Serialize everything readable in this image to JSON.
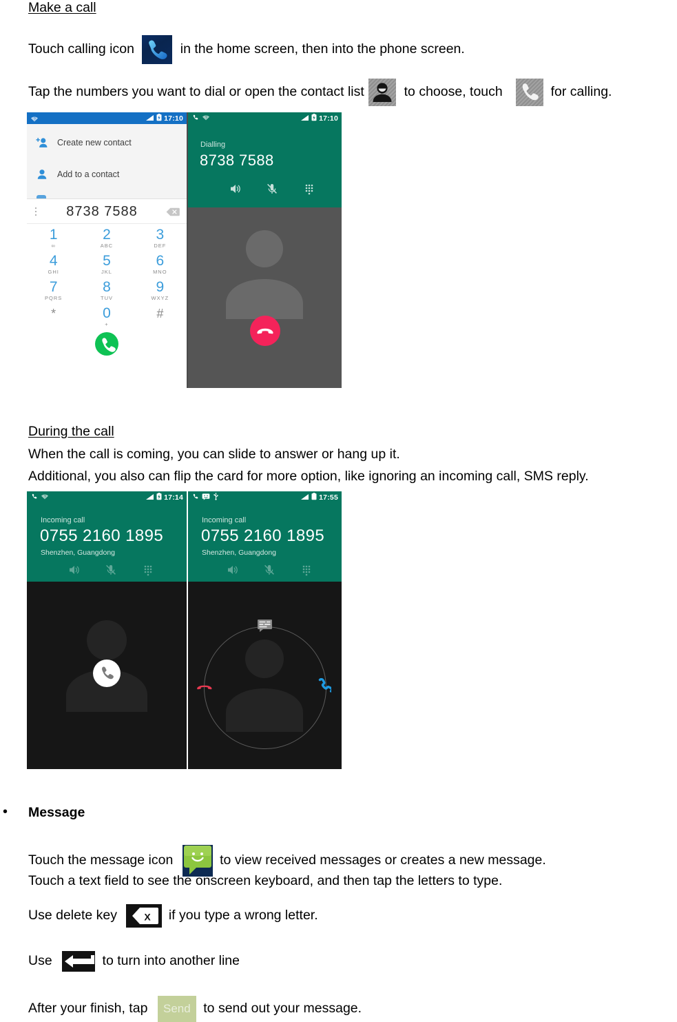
{
  "document": {
    "sections": [
      {
        "heading": "Make a call",
        "paragraphs": [
          {
            "before": "Touch calling icon",
            "icon": "phone-blue-icon",
            "after": "in the home screen, then into the phone screen."
          },
          {
            "before": "Tap the numbers you want to dial or open the contact list",
            "icon": "contact-person-icon",
            "middle": "to choose, touch",
            "icon2": "phone-handset-icon",
            "after": "for calling."
          }
        ]
      },
      {
        "heading": "During the call",
        "lines": [
          "When the call is coming, you can slide to answer or hang up it.",
          "Additional, you also can flip the card for more option, like ignoring an incoming call, SMS reply."
        ]
      },
      {
        "bullet": "•",
        "heading": "Message",
        "paragraphs": [
          {
            "before": "Touch the message icon",
            "icon": "message-bubble-icon",
            "after": "to view received messages or creates a new message."
          },
          {
            "plain": "Touch a text field to see the onscreen keyboard, and then tap the letters to type."
          },
          {
            "before": "Use delete key",
            "icon": "delete-key-icon",
            "after": "if you type a wrong letter."
          },
          {
            "before": "Use",
            "icon": "enter-key-icon",
            "after": "to turn into another line"
          },
          {
            "before": "After your finish, tap",
            "icon": "send-button-icon",
            "icon_label": "Send",
            "after": "to send out your message."
          }
        ]
      }
    ]
  },
  "figure_dialer": {
    "name": "dialer-and-dialling-screenshots",
    "left_screen": {
      "status": {
        "time": "17:10",
        "icons": [
          "wifi-icon",
          "signal-icon",
          "battery-icon"
        ]
      },
      "menu": [
        {
          "icon": "add-contact-icon",
          "label": "Create new contact"
        },
        {
          "icon": "person-icon",
          "label": "Add to a contact"
        }
      ],
      "number_field": {
        "value": "8738 7588",
        "overflow_icon": "more-vertical-icon",
        "backspace_icon": "backspace-icon"
      },
      "keypad": [
        {
          "digit": "1",
          "letters": "∞"
        },
        {
          "digit": "2",
          "letters": "ABC"
        },
        {
          "digit": "3",
          "letters": "DEF"
        },
        {
          "digit": "4",
          "letters": "GHI"
        },
        {
          "digit": "5",
          "letters": "JKL"
        },
        {
          "digit": "6",
          "letters": "MNO"
        },
        {
          "digit": "7",
          "letters": "PQRS"
        },
        {
          "digit": "8",
          "letters": "TUV"
        },
        {
          "digit": "9",
          "letters": "WXYZ"
        },
        {
          "digit": "*",
          "letters": ""
        },
        {
          "digit": "0",
          "letters": "+"
        },
        {
          "digit": "#",
          "letters": ""
        }
      ],
      "call_button": "call-fab-icon"
    },
    "right_screen": {
      "status": {
        "time": "17:10",
        "icons": [
          "call-icon",
          "wifi-icon",
          "signal-icon",
          "battery-icon"
        ]
      },
      "state": "Dialling",
      "number": "8738 7588",
      "actions": [
        "speaker-icon",
        "mute-icon",
        "keypad-icon"
      ],
      "end_call_button": "end-call-icon"
    }
  },
  "figure_incoming": {
    "name": "incoming-call-screenshots",
    "left_screen": {
      "status": {
        "time": "17:14",
        "icons": [
          "call-icon",
          "wifi-icon",
          "signal-icon",
          "battery-icon"
        ]
      },
      "state": "Incoming call",
      "number": "0755 2160 1895",
      "location": "Shenzhen, Guangdong",
      "actions": [
        "speaker-icon",
        "mute-icon",
        "keypad-icon"
      ],
      "answer_button": "answer-call-icon"
    },
    "right_screen": {
      "status": {
        "time": "17:55",
        "icons": [
          "call-icon",
          "message-icon",
          "usb-icon",
          "signal-icon",
          "battery-icon"
        ]
      },
      "state": "Incoming call",
      "number": "0755 2160 1895",
      "location": "Shenzhen, Guangdong",
      "actions": [
        "speaker-icon",
        "mute-icon",
        "keypad-icon"
      ],
      "slide_options": [
        "sms-reply-icon",
        "decline-call-icon",
        "answer-call-icon"
      ]
    }
  },
  "colors": {
    "dialer_status_bar": "#1470c4",
    "incall_teal": "#06775f",
    "keypad_digit": "#3c9ddb",
    "call_green": "#0ec254",
    "end_red": "#f4235a",
    "answer_blue": "#1e9ae0",
    "decline_red": "#e63950",
    "incall_body_gray": "#555555",
    "incall_body_black": "#161616",
    "send_button": "#c3d09a"
  }
}
